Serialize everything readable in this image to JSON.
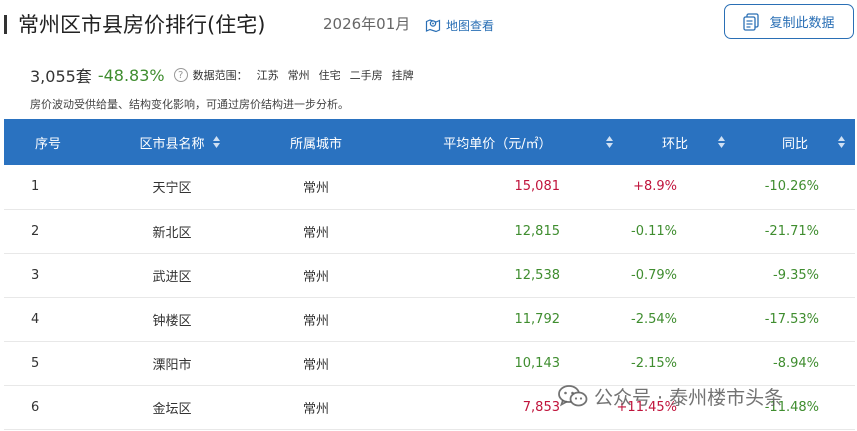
{
  "header": {
    "title": "常州区市县房价排行(住宅)",
    "date": "2026年01月",
    "map_link": "地图查看",
    "copy_button": "复制此数据"
  },
  "stats": {
    "count": "3,055套",
    "change": "-48.83%",
    "help": "?",
    "scope_label": "数据范围：",
    "scope_items": [
      "江苏",
      "常州",
      "住宅",
      "二手房",
      "挂牌"
    ]
  },
  "note": "房价波动受供给量、结构变化影响，可通过房价结构进一步分析。",
  "table": {
    "headers": [
      "序号",
      "区市县名称",
      "所属城市",
      "平均单价（元/㎡）",
      "环比",
      "同比"
    ],
    "rows": [
      {
        "rank": "1",
        "district": "天宁区",
        "city": "常州",
        "price": "15,081",
        "price_trend": "up",
        "mom": "+8.9%",
        "mom_trend": "up",
        "yoy": "-10.26%",
        "yoy_trend": "down"
      },
      {
        "rank": "2",
        "district": "新北区",
        "city": "常州",
        "price": "12,815",
        "price_trend": "down",
        "mom": "-0.11%",
        "mom_trend": "down",
        "yoy": "-21.71%",
        "yoy_trend": "down"
      },
      {
        "rank": "3",
        "district": "武进区",
        "city": "常州",
        "price": "12,538",
        "price_trend": "down",
        "mom": "-0.79%",
        "mom_trend": "down",
        "yoy": "-9.35%",
        "yoy_trend": "down"
      },
      {
        "rank": "4",
        "district": "钟楼区",
        "city": "常州",
        "price": "11,792",
        "price_trend": "down",
        "mom": "-2.54%",
        "mom_trend": "down",
        "yoy": "-17.53%",
        "yoy_trend": "down"
      },
      {
        "rank": "5",
        "district": "溧阳市",
        "city": "常州",
        "price": "10,143",
        "price_trend": "down",
        "mom": "-2.15%",
        "mom_trend": "down",
        "yoy": "-8.94%",
        "yoy_trend": "down"
      },
      {
        "rank": "6",
        "district": "金坛区",
        "city": "常州",
        "price": "7,853",
        "price_trend": "up",
        "mom": "+11.45%",
        "mom_trend": "up",
        "yoy": "-11.48%",
        "yoy_trend": "down"
      }
    ]
  },
  "watermark": "公众号 · 泰州楼市头条",
  "colors": {
    "header_bg": "#2a72c0",
    "link": "#2a6fb5",
    "up": "#c0143c",
    "down": "#3f8d2f"
  },
  "icons": {
    "map": "map-pin-icon",
    "copy": "document-copy-icon",
    "help": "help-circle-icon",
    "sort": "sort-arrows-icon",
    "wechat": "wechat-icon"
  }
}
